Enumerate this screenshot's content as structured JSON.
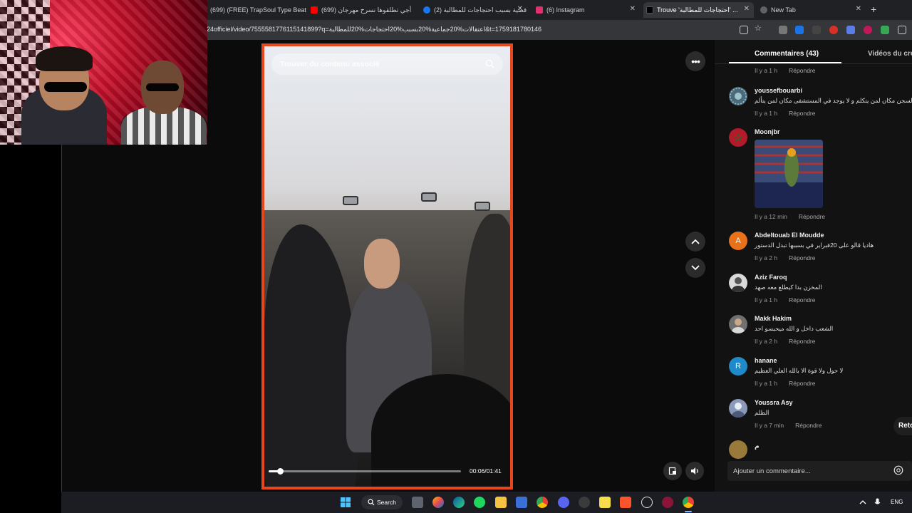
{
  "browser": {
    "tabs": [
      {
        "label": "(699) (FREE) TrapSoul Type Beat",
        "color": "#ff0000"
      },
      {
        "label": "(699) أجي تطلقوها نسرح مهرجان",
        "color": "#ff0000"
      },
      {
        "label": "(2) قضية بسبب احتجاجات للمطالبة",
        "color": "#1877f2"
      },
      {
        "label": "(6) Instagram",
        "color": "#e1306c"
      },
      {
        "label": "Trouve 'احتجاجات للمطالبة' ...",
        "color": "#000000"
      },
      {
        "label": "New Tab",
        "color": "#5f6368"
      }
    ],
    "new_tab_plus": "+",
    "url": "24officiel/video/7555581776115141899?q=اعتقالات%20جماعية%20بسبب%20احتجاجات%20للمطالبة&t=1759181780146"
  },
  "video": {
    "search_placeholder": "Trouver du contenu associé",
    "time": "00:06/01:41",
    "progress_fraction": 0.06
  },
  "panel": {
    "tab_comments": "Commentaires (43)",
    "tab_videos": "Vidéos du créateur",
    "reply_label": "Répondre",
    "comment_placeholder": "Ajouter un commentaire...",
    "retour_label": "Retour",
    "top_meta": "Il y a 1 h",
    "comments": [
      {
        "user": "youssefbouarbi",
        "text": "في السجن مكان لمن يتكلم و لا يوجد في المستشفى مكان لمن يتألم",
        "time": "Il y a 1 h",
        "avatar_letter": "",
        "avatar_color": "#4a6a7a"
      },
      {
        "user": "Moonjbr",
        "text": "",
        "time": "Il y a 12 min",
        "avatar_letter": "",
        "avatar_color": "#b31b2a"
      },
      {
        "user": "Abdeltouab El Moudde",
        "text": "هاديا قالو على 20فبراير في بسببها تبدل الدستور",
        "time": "Il y a 2 h",
        "avatar_letter": "A",
        "avatar_color": "#e8711a"
      },
      {
        "user": "Aziz Faroq",
        "text": "المخزن بدا كيطلع معه صهد",
        "time": "Il y a 1 h",
        "avatar_letter": "",
        "avatar_color": "#d9d9d9"
      },
      {
        "user": "Makk Hakim",
        "text": "الشعب داخل و الله ميحبسو احد",
        "time": "Il y a 2 h",
        "avatar_letter": "",
        "avatar_color": "#6f6f6f"
      },
      {
        "user": "hanane",
        "text": "لا حول ولا قوة الا بالله العلي العظيم",
        "time": "Il y a 1 h",
        "avatar_letter": "R",
        "avatar_color": "#1f8ac9"
      },
      {
        "user": "Youssra Asy",
        "text": "الظلم",
        "time": "Il y a 7 min",
        "avatar_letter": "",
        "avatar_color": "#8a9ab8"
      },
      {
        "user": "م",
        "text": "",
        "time": "",
        "avatar_letter": "",
        "avatar_color": "#9a7a3a"
      }
    ]
  },
  "taskbar": {
    "search_label": "Search",
    "lang": "ENG"
  }
}
